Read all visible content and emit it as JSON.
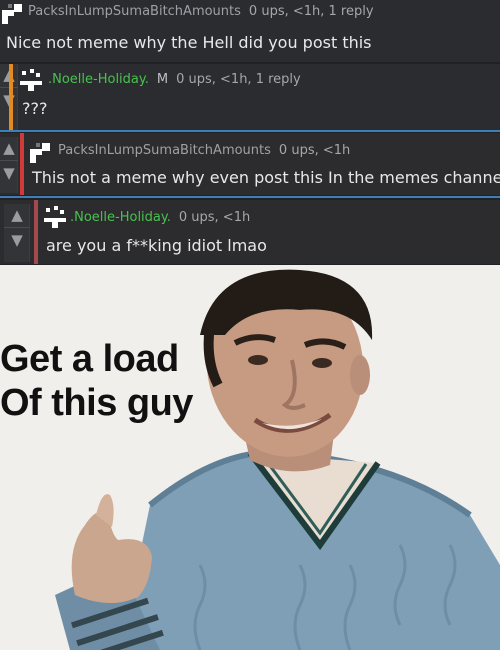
{
  "comments": [
    {
      "user": "PacksInLumpSumaBitchAmounts",
      "mod": "",
      "stats": "0 ups, <1h, 1 reply",
      "text": "Nice not meme why the Hell did you post this"
    },
    {
      "user": ".Noelle-Holiday.",
      "mod": "M",
      "stats": "0 ups, <1h, 1 reply",
      "text": "???"
    },
    {
      "user": "PacksInLumpSumaBitchAmounts",
      "mod": "",
      "stats": "0 ups, <1h",
      "text": "This not a meme why even post this In the memes channel"
    },
    {
      "user": ".Noelle-Holiday.",
      "mod": "",
      "stats": "0 ups, <1h",
      "text": "are you a f**king idiot lmao"
    }
  ],
  "meme": {
    "caption_line1": "Get a load",
    "caption_line2": "Of this guy"
  },
  "icons": {
    "upvote": "up-arrow-icon",
    "downvote": "down-arrow-icon"
  },
  "colors": {
    "username_green": "#49c14f",
    "accent_orange": "#e58a1f",
    "accent_red": "#d23a3a",
    "divider_blue": "#3f7fb8"
  }
}
